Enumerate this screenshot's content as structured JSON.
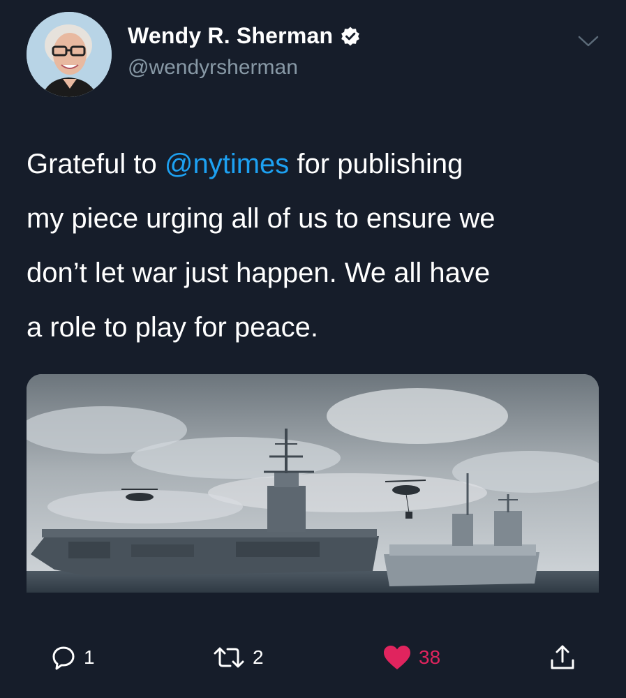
{
  "author": {
    "name": "Wendy R. Sherman",
    "handle": "@wendyrsherman",
    "verified": true
  },
  "tweet": {
    "text_prefix": "Grateful to ",
    "mention": "@nytimes",
    "text_suffix": " for publishing\nmy piece urging all of us to ensure we\ndon’t let war just happen. We all have\na role to play for peace."
  },
  "actions": {
    "reply_count": "1",
    "retweet_count": "2",
    "like_count": "38"
  },
  "colors": {
    "background": "#161d2a",
    "mention": "#1da1f2",
    "like": "#e0245e",
    "secondary_text": "#8899a6"
  },
  "icons": {
    "verified": "verified-badge-icon",
    "menu": "chevron-down-icon",
    "reply": "reply-icon",
    "retweet": "retweet-icon",
    "like": "heart-icon",
    "share": "share-icon"
  }
}
